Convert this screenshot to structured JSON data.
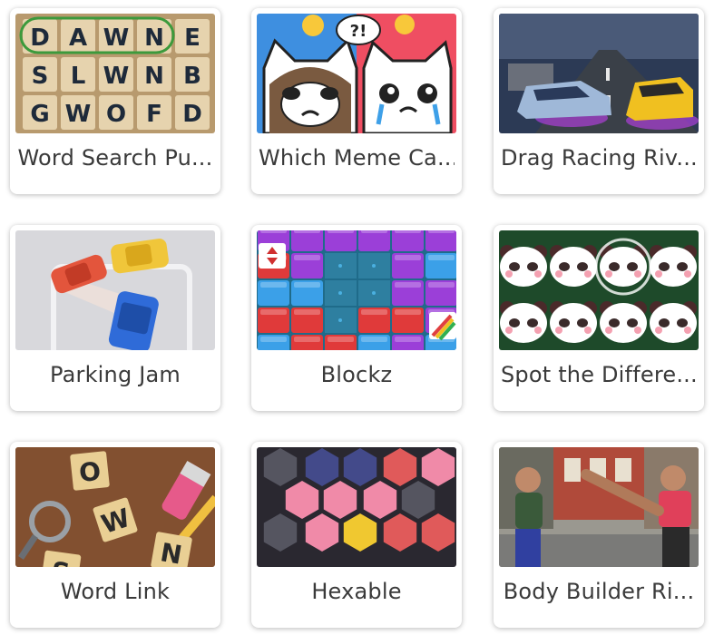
{
  "games": [
    {
      "title": "Word Search Pu...",
      "thumb_icon": "word-search-thumbnail",
      "letters": [
        "D",
        "A",
        "W",
        "N",
        "E",
        "S",
        "L",
        "W",
        "N",
        "B",
        "G",
        "W",
        "O",
        "F",
        "D"
      ]
    },
    {
      "title": "Which Meme Ca...",
      "thumb_icon": "meme-cats-thumbnail",
      "bubble_text": "?!"
    },
    {
      "title": "Drag Racing Riv...",
      "thumb_icon": "racing-cars-thumbnail"
    },
    {
      "title": "Parking Jam",
      "thumb_icon": "parking-cars-thumbnail"
    },
    {
      "title": "Blockz",
      "thumb_icon": "block-puzzle-thumbnail"
    },
    {
      "title": "Spot the Differe...",
      "thumb_icon": "panda-grid-thumbnail"
    },
    {
      "title": "Word Link",
      "thumb_icon": "letter-tiles-thumbnail",
      "letters": [
        "O",
        "W",
        "N",
        "S"
      ]
    },
    {
      "title": "Hexable",
      "thumb_icon": "hexagon-grid-thumbnail"
    },
    {
      "title": "Body Builder Ri...",
      "thumb_icon": "fighters-thumbnail"
    }
  ]
}
